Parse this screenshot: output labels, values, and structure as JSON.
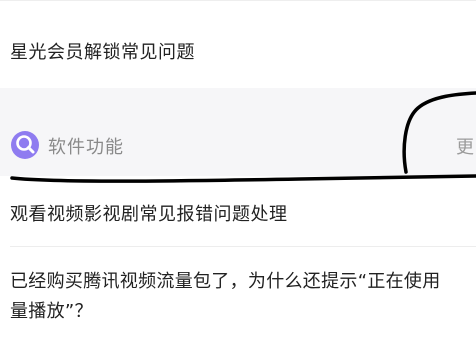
{
  "top_item": {
    "label": "星光会员解锁常见问题"
  },
  "section": {
    "title": "软件功能",
    "more_label": "更"
  },
  "items": [
    {
      "label": "观看视频影视剧常见报错问题处理"
    },
    {
      "line1": "已经购买腾讯视频流量包了，为什么还提示“正在使用",
      "line2": "量播放”？"
    }
  ],
  "colors": {
    "icon_bg": "#8f7cf0",
    "section_bg": "#f6f6f8",
    "ink": "#000000"
  },
  "icons": {
    "section_icon": "wrench-icon"
  }
}
